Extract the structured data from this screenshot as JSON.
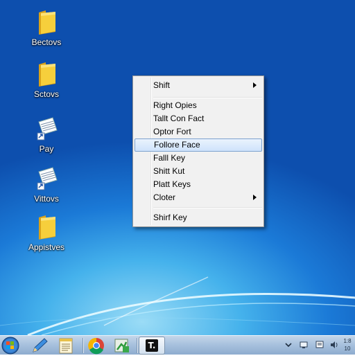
{
  "desktop": {
    "icons": [
      {
        "label": "Bectovs",
        "icon": "folder-icon"
      },
      {
        "label": "Sctovs",
        "icon": "folder-icon"
      },
      {
        "label": "Pay",
        "icon": "document-shortcut-icon"
      },
      {
        "label": "Vittovs",
        "icon": "document-shortcut-icon"
      },
      {
        "label": "Appistves",
        "icon": "folder-icon"
      }
    ]
  },
  "context_menu": {
    "items": [
      {
        "label": "Shift",
        "has_submenu": true
      },
      {
        "label": "Right Opies"
      },
      {
        "label": "Tallt Con Fact"
      },
      {
        "label": "Optor Fort"
      },
      {
        "label": "Follore Face",
        "highlighted": true
      },
      {
        "label": "Falll Key"
      },
      {
        "label": "Shitt Kut"
      },
      {
        "label": "Platt Keys"
      },
      {
        "label": "Cloter",
        "has_submenu": true
      },
      {
        "label": "Shirf Key"
      }
    ]
  },
  "taskbar": {
    "buttons": [
      {
        "icon": "start-orb-icon"
      },
      {
        "icon": "pen-icon"
      },
      {
        "icon": "notepad-icon"
      },
      {
        "icon": "chrome-icon"
      },
      {
        "icon": "green-app-icon"
      },
      {
        "icon": "terminal-icon",
        "label": "T."
      }
    ],
    "tray": {
      "icons": [
        "chevron-up-icon",
        "network-icon",
        "action-center-icon",
        "volume-icon"
      ],
      "clock_line1": "1:8",
      "clock_line2": "10"
    }
  },
  "colors": {
    "desktop_dark": "#0d4fae",
    "desktop_light": "#9bdcf6",
    "menu_highlight": "#cfe3fb",
    "taskbar": "#a9c2de"
  }
}
